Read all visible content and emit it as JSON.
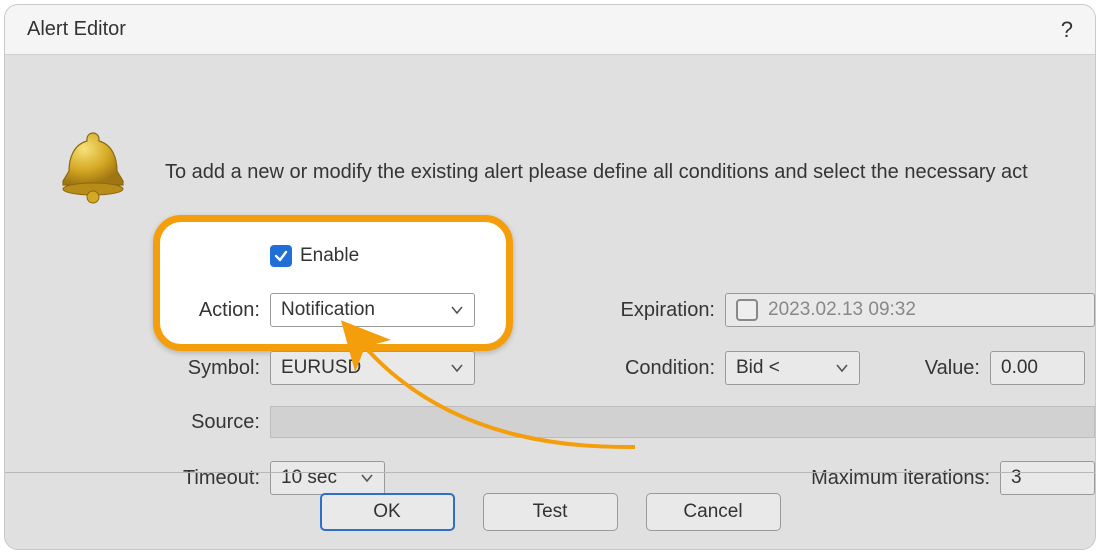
{
  "titlebar": {
    "title": "Alert Editor",
    "help": "?"
  },
  "instruction": "To add a new or modify the existing alert please define all conditions and select the necessary act",
  "labels": {
    "enable": "Enable",
    "action": "Action:",
    "expiration": "Expiration:",
    "symbol": "Symbol:",
    "condition": "Condition:",
    "value": "Value:",
    "source": "Source:",
    "timeout": "Timeout:",
    "max_iter": "Maximum iterations:"
  },
  "fields": {
    "action": "Notification",
    "expiration": "2023.02.13 09:32",
    "symbol": "EURUSD",
    "condition": "Bid <",
    "value": "0.00",
    "source": "",
    "timeout": "10 sec",
    "max_iter": "3"
  },
  "buttons": {
    "ok": "OK",
    "test": "Test",
    "cancel": "Cancel"
  }
}
